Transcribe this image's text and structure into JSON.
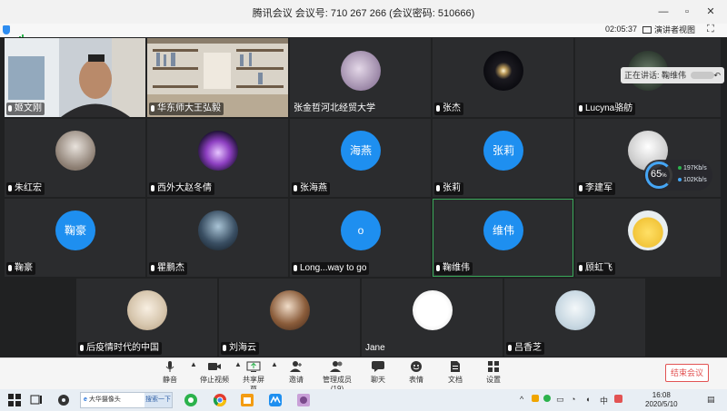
{
  "window": {
    "title": "腾讯会议 会议号: 710 267 266  (会议密码: 510666)",
    "minimize_glyph": "—",
    "restore_glyph": "▫",
    "close_glyph": "✕"
  },
  "status": {
    "timer": "02:05:37",
    "speaker_view_label": "演讲者视图",
    "fullscreen_glyph": "⛶"
  },
  "speaking": {
    "prefix": "正在讲话:",
    "name": "鞠维伟",
    "collapse_glyph": "↶"
  },
  "network": {
    "percent": "65",
    "percent_unit": "%",
    "up": "197",
    "down": "102",
    "rate_unit": "Kb/s",
    "up_color": "#2bb24c",
    "down_color": "#45a6f5"
  },
  "participants": [
    {
      "name": "姬文刚",
      "kind": "video-person"
    },
    {
      "name": "华东师大王弘毅",
      "kind": "video-shelf"
    },
    {
      "name": "张金哲河北经贸大学",
      "kind": "photo"
    },
    {
      "name": "张杰",
      "kind": "photo"
    },
    {
      "name": "Lucyna骆舫",
      "kind": "photo"
    },
    {
      "name": "朱红宏",
      "kind": "photo"
    },
    {
      "name": "西外大赵冬倩",
      "kind": "photo"
    },
    {
      "name": "张海燕",
      "kind": "initials",
      "initials": "海燕"
    },
    {
      "name": "张莉",
      "kind": "initials",
      "initials": "张莉"
    },
    {
      "name": "李建军",
      "kind": "photo"
    },
    {
      "name": "鞠豪",
      "kind": "initials",
      "initials": "鞠豪"
    },
    {
      "name": "瞿鹏杰",
      "kind": "photo"
    },
    {
      "name": "Long...way to go",
      "kind": "initials",
      "initials": "o"
    },
    {
      "name": "鞠维伟",
      "kind": "initials",
      "initials": "维伟"
    },
    {
      "name": "顾虹飞",
      "kind": "photo"
    },
    {
      "name": "后疫情时代的中国",
      "kind": "photo"
    },
    {
      "name": "刘海云",
      "kind": "photo"
    },
    {
      "name": "Jane",
      "kind": "photo"
    },
    {
      "name": "吕香芝",
      "kind": "photo"
    }
  ],
  "toolbar": {
    "mute": "静音",
    "stop_video": "停止视频",
    "share_screen": "共享屏幕",
    "invite": "邀请",
    "manage_members": "管理成员(19)",
    "chat": "聊天",
    "reactions": "表情",
    "docs": "文档",
    "settings": "设置",
    "end_meeting": "结束会议"
  },
  "taskbar": {
    "search_text": "大华摄像头",
    "search_button": "搜索一下",
    "ime": "中",
    "time": "16:08",
    "date": "2020/5/10"
  },
  "colors": {
    "accent_blue": "#1e8ff0",
    "end_red": "#e25353",
    "active_green": "#3aaa5a"
  }
}
